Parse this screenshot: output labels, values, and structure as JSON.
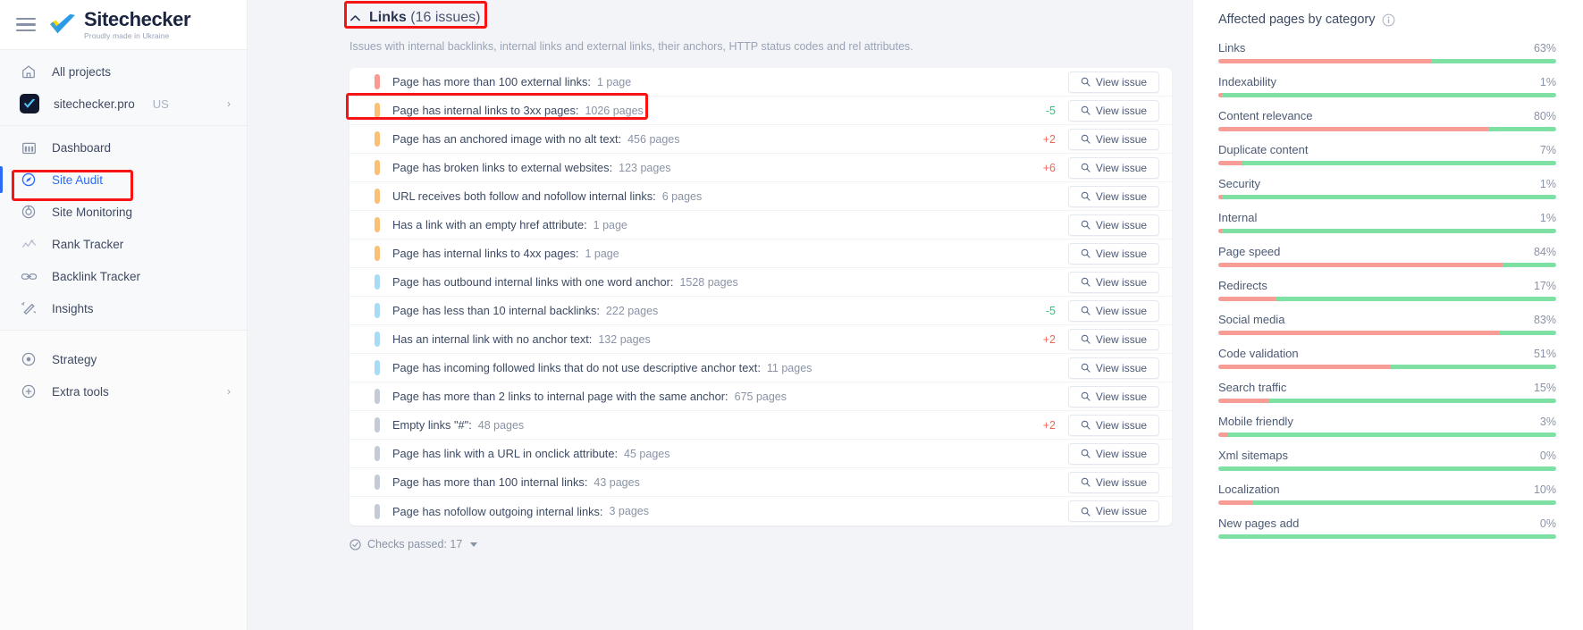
{
  "brand": {
    "name": "Sitechecker",
    "tagline": "Proudly made in Ukraine",
    "menu_icon": "hamburger-icon",
    "logo_icon": "sitechecker-check-logo"
  },
  "sidebar": {
    "top_items": [
      {
        "label": "All projects",
        "icon": "home-icon",
        "active": false
      },
      {
        "label": "sitechecker.pro",
        "country": "US",
        "icon": "project-avatar-icon",
        "active": false,
        "chevron": "›"
      }
    ],
    "nav_items": [
      {
        "label": "Dashboard",
        "icon": "dashboard-icon",
        "active": false
      },
      {
        "label": "Site Audit",
        "icon": "site-audit-icon",
        "active": true
      },
      {
        "label": "Site Monitoring",
        "icon": "site-monitoring-icon",
        "active": false
      },
      {
        "label": "Rank Tracker",
        "icon": "rank-tracker-icon",
        "active": false
      },
      {
        "label": "Backlink Tracker",
        "icon": "backlink-tracker-icon",
        "active": false
      },
      {
        "label": "Insights",
        "icon": "insights-icon",
        "active": false
      }
    ],
    "bottom_items": [
      {
        "label": "Strategy",
        "icon": "strategy-icon",
        "active": false
      },
      {
        "label": "Extra tools",
        "icon": "extra-tools-icon",
        "active": false,
        "chevron": "›"
      }
    ]
  },
  "section": {
    "collapse_icon": "caret-up-icon",
    "title": "Links",
    "count_label": "(16 issues)",
    "description": "Issues with internal backlinks, internal links and external links, their anchors, HTTP status codes and rel attributes."
  },
  "issues": [
    {
      "label": "Page has more than 100 external links",
      "count": "1 page",
      "delta": "",
      "delta_dir": "",
      "severity": "critical",
      "action": "View issue"
    },
    {
      "label": "Page has internal links to 3xx pages",
      "count": "1026 pages",
      "delta": "-5",
      "delta_dir": "down",
      "severity": "warning",
      "action": "View issue"
    },
    {
      "label": "Page has an anchored image with no alt text",
      "count": "456 pages",
      "delta": "+2",
      "delta_dir": "up",
      "severity": "warning",
      "action": "View issue"
    },
    {
      "label": "Page has broken links to external websites",
      "count": "123 pages",
      "delta": "+6",
      "delta_dir": "up",
      "severity": "warning",
      "action": "View issue"
    },
    {
      "label": "URL receives both follow and nofollow internal links",
      "count": "6 pages",
      "delta": "",
      "delta_dir": "",
      "severity": "warning",
      "action": "View issue"
    },
    {
      "label": "Has a link with an empty href attribute",
      "count": "1 page",
      "delta": "",
      "delta_dir": "",
      "severity": "warning",
      "action": "View issue"
    },
    {
      "label": "Page has internal links to 4xx pages",
      "count": "1 page",
      "delta": "",
      "delta_dir": "",
      "severity": "warning",
      "action": "View issue"
    },
    {
      "label": "Page has outbound internal links with one word anchor",
      "count": "1528 pages",
      "delta": "",
      "delta_dir": "",
      "severity": "notice",
      "action": "View issue"
    },
    {
      "label": "Page has less than 10 internal backlinks",
      "count": "222 pages",
      "delta": "-5",
      "delta_dir": "down",
      "severity": "notice",
      "action": "View issue"
    },
    {
      "label": "Has an internal link with no anchor text",
      "count": "132 pages",
      "delta": "+2",
      "delta_dir": "up",
      "severity": "notice",
      "action": "View issue"
    },
    {
      "label": "Page has incoming followed links that do not use descriptive anchor text",
      "count": "11 pages",
      "delta": "",
      "delta_dir": "",
      "severity": "notice",
      "action": "View issue"
    },
    {
      "label": "Page has more than 2 links to internal page with the same anchor",
      "count": "675 pages",
      "delta": "",
      "delta_dir": "",
      "severity": "info",
      "action": "View issue"
    },
    {
      "label": "Empty links \"#\"",
      "count": "48 pages",
      "delta": "+2",
      "delta_dir": "up",
      "severity": "info",
      "action": "View issue"
    },
    {
      "label": "Page has link with a URL in onclick attribute",
      "count": "45 pages",
      "delta": "",
      "delta_dir": "",
      "severity": "info",
      "action": "View issue"
    },
    {
      "label": "Page has more than 100 internal links",
      "count": "43 pages",
      "delta": "",
      "delta_dir": "",
      "severity": "info",
      "action": "View issue"
    },
    {
      "label": "Page has nofollow outgoing internal links",
      "count": "3 pages",
      "delta": "",
      "delta_dir": "",
      "severity": "info",
      "action": "View issue"
    }
  ],
  "checks_passed": {
    "label": "Checks passed: 17",
    "icon": "check-circle-icon"
  },
  "right_panel": {
    "title": "Affected pages by category",
    "info_icon": "info-icon",
    "colors": {
      "affected": "#f79d95",
      "ok": "#7fe0a4"
    },
    "categories": [
      {
        "name": "Links",
        "pct": "63%",
        "value": 63
      },
      {
        "name": "Indexability",
        "pct": "1%",
        "value": 1
      },
      {
        "name": "Content relevance",
        "pct": "80%",
        "value": 80
      },
      {
        "name": "Duplicate content",
        "pct": "7%",
        "value": 7
      },
      {
        "name": "Security",
        "pct": "1%",
        "value": 1
      },
      {
        "name": "Internal",
        "pct": "1%",
        "value": 1
      },
      {
        "name": "Page speed",
        "pct": "84%",
        "value": 84
      },
      {
        "name": "Redirects",
        "pct": "17%",
        "value": 17
      },
      {
        "name": "Social media",
        "pct": "83%",
        "value": 83
      },
      {
        "name": "Code validation",
        "pct": "51%",
        "value": 51
      },
      {
        "name": "Search traffic",
        "pct": "15%",
        "value": 15
      },
      {
        "name": "Mobile friendly",
        "pct": "3%",
        "value": 3
      },
      {
        "name": "Xml sitemaps",
        "pct": "0%",
        "value": 0
      },
      {
        "name": "Localization",
        "pct": "10%",
        "value": 10
      },
      {
        "name": "New pages add",
        "pct": "0%",
        "value": 0
      }
    ]
  },
  "annotations": [
    {
      "name": "highlight-section-title"
    },
    {
      "name": "highlight-sidebar-site-audit"
    },
    {
      "name": "highlight-issue-row-3xx"
    }
  ]
}
